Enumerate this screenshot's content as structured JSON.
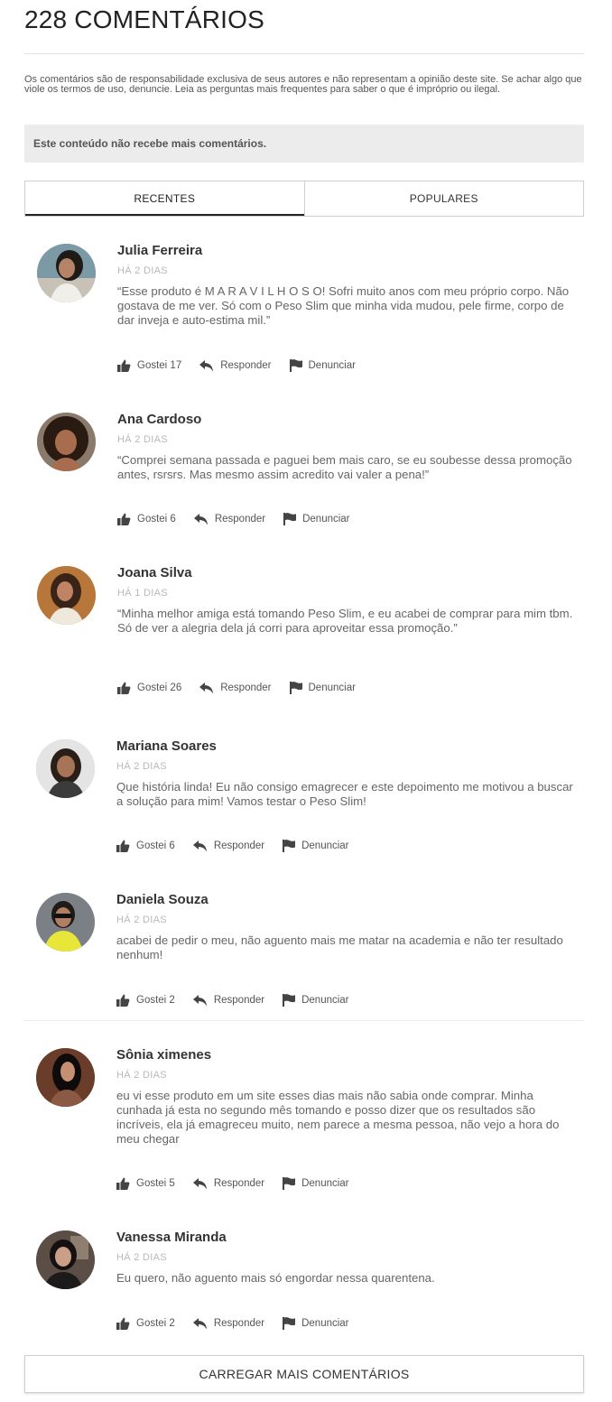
{
  "header": {
    "title": "228 COMENTÁRIOS",
    "disclaimer": "Os comentários são de responsabilidade exclusiva de seus autores e não representam a opinião deste site. Se achar algo que viole os termos de uso, denuncie. Leia as perguntas mais frequentes para saber o que é impróprio ou ilegal.",
    "closed_notice": "Este conteúdo não recebe mais comentários."
  },
  "tabs": [
    {
      "label": "RECENTES",
      "active": true
    },
    {
      "label": "POPULARES",
      "active": false
    }
  ],
  "actions": {
    "like_prefix": "Gostei",
    "reply": "Responder",
    "report": "Denunciar"
  },
  "icons": {
    "like": "thumbs-up-icon",
    "reply": "reply-arrow-icon",
    "report": "flag-icon"
  },
  "comments": [
    {
      "name": "Julia Ferreira",
      "time": "HÁ 2 DIAS",
      "text": "“Esse produto é M A R A V I L H O S O! Sofri muito anos com meu próprio corpo. Não gostava de me ver. Só com o Peso Slim que minha vida mudou, pele firme, corpo de dar inveja e auto-estima mil.”",
      "likes": "Gostei 17"
    },
    {
      "name": "Ana Cardoso",
      "time": "HÁ 2 DIAS",
      "text": "“Comprei semana passada e paguei bem mais caro, se eu soubesse dessa promoção antes, rsrsrs. Mas mesmo assim acredito vai valer a pena!”",
      "likes": "Gostei 6"
    },
    {
      "name": "Joana Silva",
      "time": "HÁ 1 DIAS",
      "text": "“Minha melhor amiga está tomando Peso Slim, e eu acabei de comprar para mim tbm. Só de ver a alegria dela já corri para aproveitar essa promoção.”",
      "likes": "Gostei 26"
    },
    {
      "name": "Mariana Soares",
      "time": "HÁ 2 DIAS",
      "text": "Que história linda! Eu não consigo emagrecer e este depoimento me motivou a buscar a solução para mim! Vamos testar o Peso Slim!",
      "likes": "Gostei 6"
    },
    {
      "name": "Daniela Souza",
      "time": "HÁ 2 DIAS",
      "text": "acabei de pedir o meu, não aguento mais me matar na academia e não ter resultado nenhum!",
      "likes": "Gostei 2"
    },
    {
      "name": "Sônia ximenes",
      "time": "HÁ 2 DIAS",
      "text": "eu vi esse produto em um site esses dias mais não sabia onde comprar. Minha cunhada já esta no segundo mês tomando e posso dizer que os resultados são incríveis, ela já emagreceu muito, nem parece a mesma pessoa, não vejo a hora do meu chegar",
      "likes": "Gostei 5"
    },
    {
      "name": "Vanessa Miranda",
      "time": "HÁ 2 DIAS",
      "text": "Eu quero, não aguento mais só engordar nessa quarentena.",
      "likes": "Gostei 2"
    }
  ],
  "load_more": "CARREGAR MAIS COMENTÁRIOS"
}
